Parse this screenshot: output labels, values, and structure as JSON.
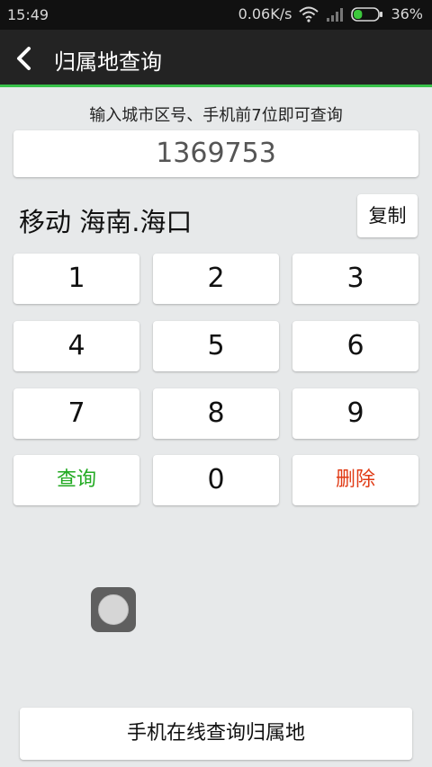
{
  "status_bar": {
    "time": "15:49",
    "net_speed": "0.06K/s",
    "battery": "36%",
    "battery_level": 0.36,
    "battery_color": "#3cc83c"
  },
  "header": {
    "title": "归属地查询",
    "accent_color": "#38c24a"
  },
  "hint": "输入城市区号、手机前7位即可查询",
  "input_value": "1369753",
  "result": "移动 海南.海口",
  "copy_label": "复制",
  "keypad": {
    "key_1": "1",
    "key_2": "2",
    "key_3": "3",
    "key_4": "4",
    "key_5": "5",
    "key_6": "6",
    "key_7": "7",
    "key_8": "8",
    "key_9": "9",
    "key_0": "0",
    "query": "查询",
    "delete": "删除",
    "query_color": "#22aa22",
    "delete_color": "#e03a14"
  },
  "online_query": "手机在线查询归属地"
}
